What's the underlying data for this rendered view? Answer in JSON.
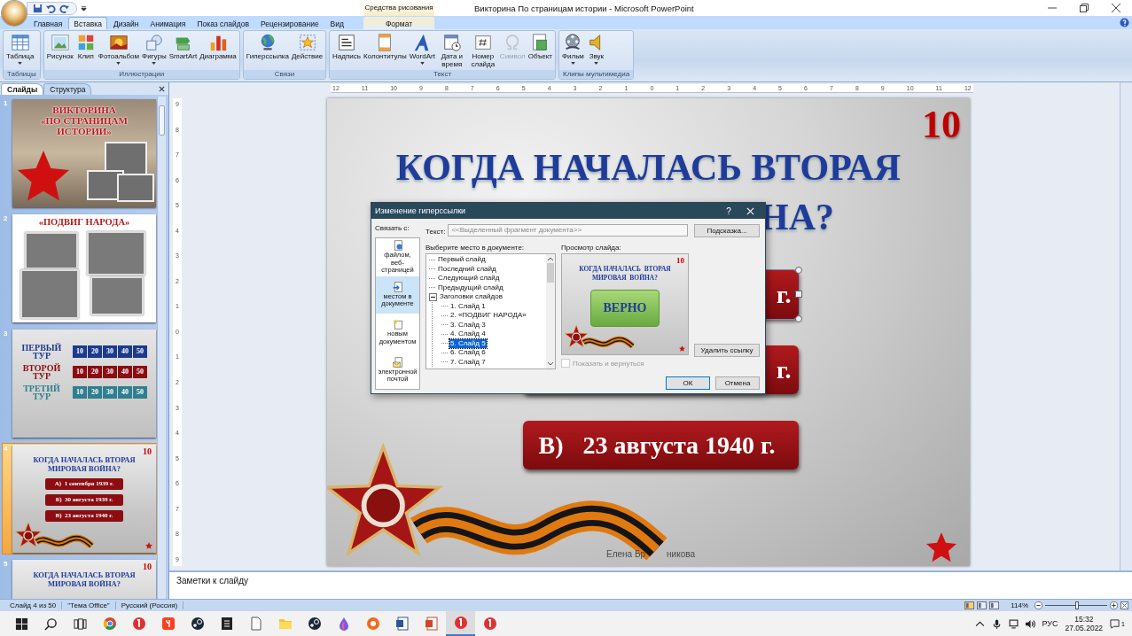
{
  "window": {
    "title": "Викторина По страницам истории - Microsoft PowerPoint",
    "contextual_tab_group": "Средства рисования"
  },
  "ribbon": {
    "tabs": [
      {
        "label": "Главная",
        "selected": false,
        "contextual": false
      },
      {
        "label": "Вставка",
        "selected": true,
        "contextual": false
      },
      {
        "label": "Дизайн",
        "selected": false,
        "contextual": false
      },
      {
        "label": "Анимация",
        "selected": false,
        "contextual": false
      },
      {
        "label": "Показ слайдов",
        "selected": false,
        "contextual": false
      },
      {
        "label": "Рецензирование",
        "selected": false,
        "contextual": false
      },
      {
        "label": "Вид",
        "selected": false,
        "contextual": false
      },
      {
        "label": "Формат",
        "selected": false,
        "contextual": true
      }
    ],
    "groups": [
      {
        "label": "Таблицы",
        "buttons": [
          {
            "label": "Таблица",
            "kind": "table",
            "dropdown": true,
            "disabled": false
          }
        ]
      },
      {
        "label": "Иллюстрации",
        "buttons": [
          {
            "label": "Рисунок",
            "kind": "picture",
            "dropdown": false,
            "disabled": false
          },
          {
            "label": "Клип",
            "kind": "clip",
            "dropdown": false,
            "disabled": false
          },
          {
            "label": "Фотоальбом",
            "kind": "album",
            "dropdown": true,
            "disabled": false
          },
          {
            "label": "Фигуры",
            "kind": "shapes",
            "dropdown": true,
            "disabled": false
          },
          {
            "label": "SmartArt",
            "kind": "smartart",
            "dropdown": false,
            "disabled": false
          },
          {
            "label": "Диаграмма",
            "kind": "chart",
            "dropdown": false,
            "disabled": false
          }
        ]
      },
      {
        "label": "Связи",
        "buttons": [
          {
            "label": "Гиперссылка",
            "kind": "hyperlink",
            "dropdown": false,
            "disabled": false
          },
          {
            "label": "Действие",
            "kind": "action",
            "dropdown": false,
            "disabled": false
          }
        ]
      },
      {
        "label": "Текст",
        "buttons": [
          {
            "label": "Надпись",
            "kind": "textbox",
            "dropdown": false,
            "disabled": false
          },
          {
            "label": "Колонтитулы",
            "kind": "header",
            "dropdown": false,
            "disabled": false
          },
          {
            "label": "WordArt",
            "kind": "wordart",
            "dropdown": true,
            "disabled": false
          },
          {
            "label": "Дата и время",
            "kind": "date",
            "dropdown": false,
            "disabled": false
          },
          {
            "label": "Номер слайда",
            "kind": "slidenum",
            "dropdown": false,
            "disabled": false
          },
          {
            "label": "Символ",
            "kind": "symbol",
            "dropdown": false,
            "disabled": true
          },
          {
            "label": "Объект",
            "kind": "object",
            "dropdown": false,
            "disabled": false
          }
        ]
      },
      {
        "label": "Клипы мультимедиа",
        "buttons": [
          {
            "label": "Фильм",
            "kind": "movie",
            "dropdown": true,
            "disabled": false
          },
          {
            "label": "Звук",
            "kind": "sound",
            "dropdown": true,
            "disabled": false
          }
        ]
      }
    ]
  },
  "slides_panel": {
    "tabs": [
      {
        "label": "Слайды",
        "selected": true
      },
      {
        "label": "Структура",
        "selected": false
      }
    ],
    "thumbnails": [
      {
        "number": "1",
        "kind": "title",
        "selected": false,
        "title_lines": [
          "ВИКТОРИНА",
          "«ПО СТРАНИЦАМ",
          "ИСТОРИИ»"
        ]
      },
      {
        "number": "2",
        "kind": "collage",
        "selected": false,
        "title_lines": [
          "«ПОДВИГ НАРОДА»"
        ]
      },
      {
        "number": "3",
        "kind": "board",
        "selected": false,
        "rounds": [
          {
            "lines": [
              "ПЕРВЫЙ",
              "ТУР"
            ],
            "color": "#1c3a8f",
            "scores": [
              "10",
              "20",
              "30",
              "40",
              "50"
            ]
          },
          {
            "lines": [
              "ВТОРОЙ",
              "ТУР"
            ],
            "color": "#8b0d12",
            "scores": [
              "10",
              "20",
              "30",
              "40",
              "50"
            ]
          },
          {
            "lines": [
              "ТРЕТИЙ",
              "ТУР"
            ],
            "color": "#2f7f8f",
            "scores": [
              "10",
              "20",
              "30",
              "40",
              "50"
            ]
          }
        ]
      },
      {
        "number": "4",
        "kind": "question",
        "selected": true,
        "score": "10",
        "title_lines": [
          "КОГДА НАЧАЛАСЬ ВТОРАЯ",
          "МИРОВАЯ ВОЙНА?"
        ],
        "answers": [
          {
            "letter": "А)",
            "text": "1 сентября 1939 г."
          },
          {
            "letter": "Б)",
            "text": "30 августа 1939 г."
          },
          {
            "letter": "В)",
            "text": "23 августа 1940 г."
          }
        ]
      },
      {
        "number": "5",
        "kind": "question",
        "selected": false,
        "score": "10",
        "title_lines": [
          "КОГДА НАЧАЛАСЬ ВТОРАЯ",
          "МИРОВАЯ ВОЙНА?"
        ]
      }
    ]
  },
  "rulers": {
    "horizontal": [
      "12",
      "11",
      "10",
      "9",
      "8",
      "7",
      "6",
      "5",
      "4",
      "3",
      "2",
      "1",
      "0",
      "1",
      "2",
      "3",
      "4",
      "5",
      "6",
      "7",
      "8",
      "9",
      "10",
      "11",
      "12"
    ],
    "vertical": [
      "9",
      "8",
      "7",
      "6",
      "5",
      "4",
      "3",
      "2",
      "1",
      "0",
      "1",
      "2",
      "3",
      "4",
      "5",
      "6",
      "7",
      "8",
      "9"
    ]
  },
  "slide": {
    "score": "10",
    "title_lines": [
      "КОГДА НАЧАЛАСЬ ВТОРАЯ",
      "НА?"
    ],
    "answers": [
      {
        "text": "г.",
        "selected": true
      },
      {
        "text": "г.",
        "selected": false
      },
      {
        "letter": "В)",
        "text": "23 августа 1940 г.",
        "selected": false
      }
    ],
    "author_fragments": [
      "Елена Бр",
      "никова"
    ]
  },
  "dialog": {
    "title": "Изменение гиперссылки",
    "help": "?",
    "link_to_label": "Связать с:",
    "link_targets": [
      {
        "label": "файлом, веб-страницей",
        "kind": "file",
        "selected": false
      },
      {
        "label": "местом в документе",
        "kind": "place",
        "selected": true
      },
      {
        "label": "новым документом",
        "kind": "new",
        "selected": false
      },
      {
        "label": "электронной почтой",
        "kind": "mail",
        "selected": false
      }
    ],
    "text_label": "Текст:",
    "text_value": "<<Выделенный фрагмент документа>>",
    "text_disabled": true,
    "hint_button": "Подсказка...",
    "place_label": "Выберите место в документе:",
    "tree": [
      {
        "label": "Первый слайд",
        "selected": false
      },
      {
        "label": "Последний слайд",
        "selected": false
      },
      {
        "label": "Следующий слайд",
        "selected": false
      },
      {
        "label": "Предыдущий слайд",
        "selected": false
      },
      {
        "label": "Заголовки слайдов",
        "selected": false,
        "expanded": true,
        "children": [
          {
            "label": "1. Слайд 1",
            "selected": false
          },
          {
            "label": "2. «ПОДВИГ НАРОДА»",
            "selected": false
          },
          {
            "label": "3. Слайд 3",
            "selected": false
          },
          {
            "label": "4. Слайд 4",
            "selected": false
          },
          {
            "label": "5. Слайд 5",
            "selected": true
          },
          {
            "label": "6. Слайд 6",
            "selected": false
          },
          {
            "label": "7. Слайд 7",
            "selected": false
          }
        ]
      }
    ],
    "preview_label": "Просмотр слайда:",
    "preview": {
      "score": "10",
      "title_lines": [
        "КОГДА НАЧАЛАСЬ  ВТОРАЯ",
        "МИРОВАЯ  ВОЙНА?"
      ],
      "answer_button": "ВЕРНО"
    },
    "show_and_return": {
      "label": "Показать и вернуться",
      "checked": false,
      "disabled": true
    },
    "remove_button": "Удалить ссылку",
    "ok_button": "ОК",
    "cancel_button": "Отмена"
  },
  "notes": {
    "text": "Заметки к слайду"
  },
  "status_bar": {
    "slide_info": "Слайд 4 из 50",
    "theme": "\"Тема Office\"",
    "language": "Русский (Россия)",
    "views": [
      {
        "selected": true
      },
      {
        "selected": false
      },
      {
        "selected": false
      }
    ],
    "zoom": {
      "label": "114%",
      "level": 0.52
    }
  },
  "taskbar": {
    "apps": [
      {
        "selected": false
      },
      {
        "selected": false
      },
      {
        "selected": false
      },
      {
        "selected": false
      },
      {
        "selected": false
      },
      {
        "selected": false
      },
      {
        "selected": false
      },
      {
        "selected": false
      },
      {
        "selected": false
      },
      {
        "selected": false
      },
      {
        "selected": false
      },
      {
        "selected": false
      },
      {
        "selected": true
      },
      {
        "selected": false
      }
    ],
    "language": "РУС",
    "time": "15:32",
    "date": "27.05.2022",
    "notifications": "1"
  }
}
